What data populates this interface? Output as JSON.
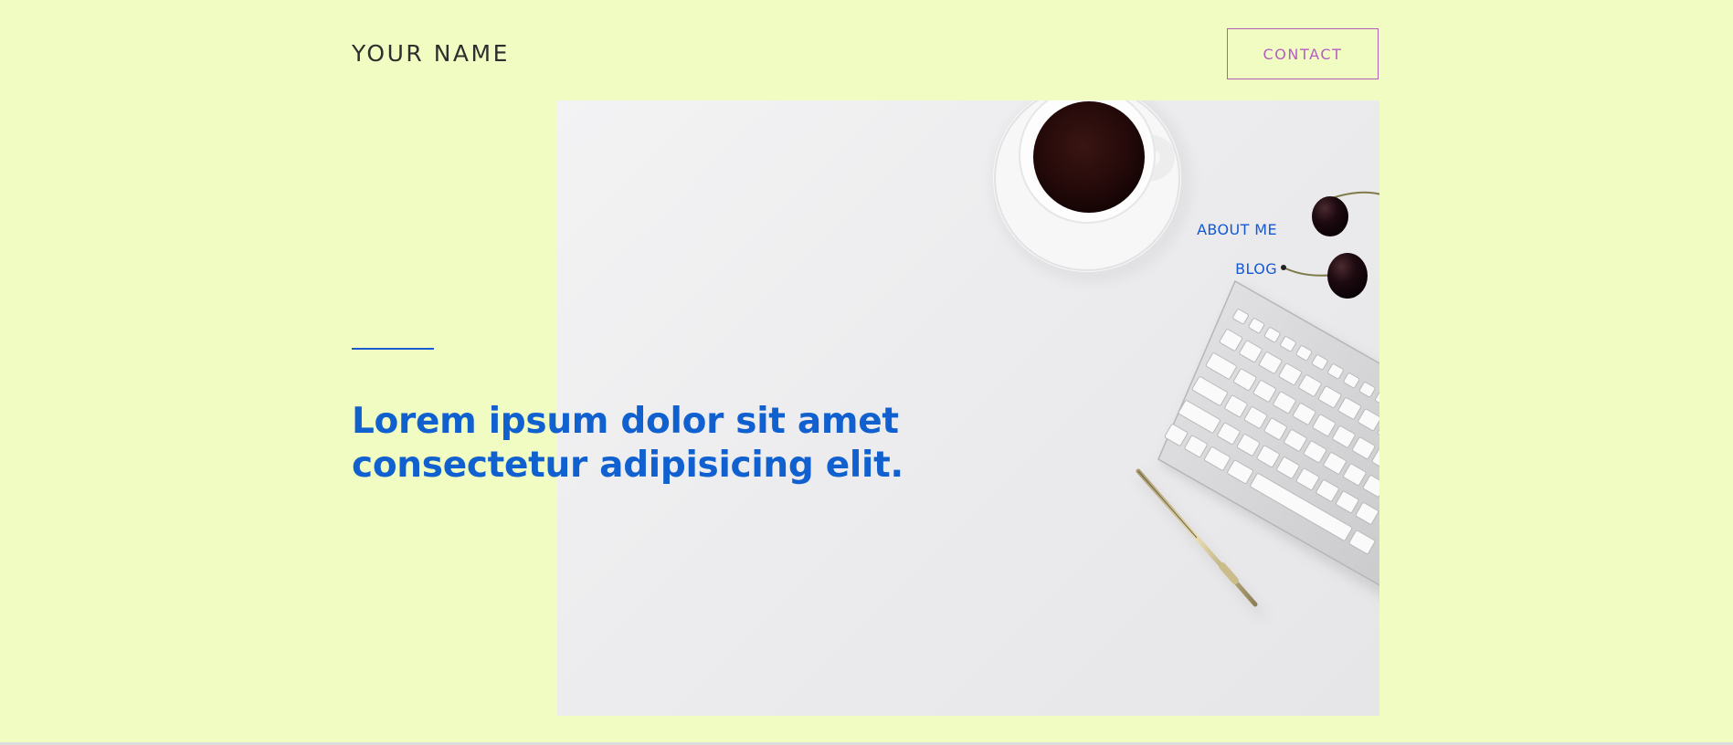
{
  "header": {
    "brand": "YOUR NAME",
    "contact_label": "CONTACT"
  },
  "nav": {
    "items": [
      {
        "label": "ABOUT ME"
      },
      {
        "label": "BLOG"
      }
    ]
  },
  "hero": {
    "headline": "Lorem ipsum dolor sit amet consectetur adipisicing elit."
  },
  "colors": {
    "page_background": "#f0fcc2",
    "accent_blue": "#1160cf",
    "contact_purple": "#b65cc5",
    "brand_text": "#2e2e2e"
  },
  "icons": {
    "hero_photo": "desk-photo-coffee-keyboard-pen"
  }
}
